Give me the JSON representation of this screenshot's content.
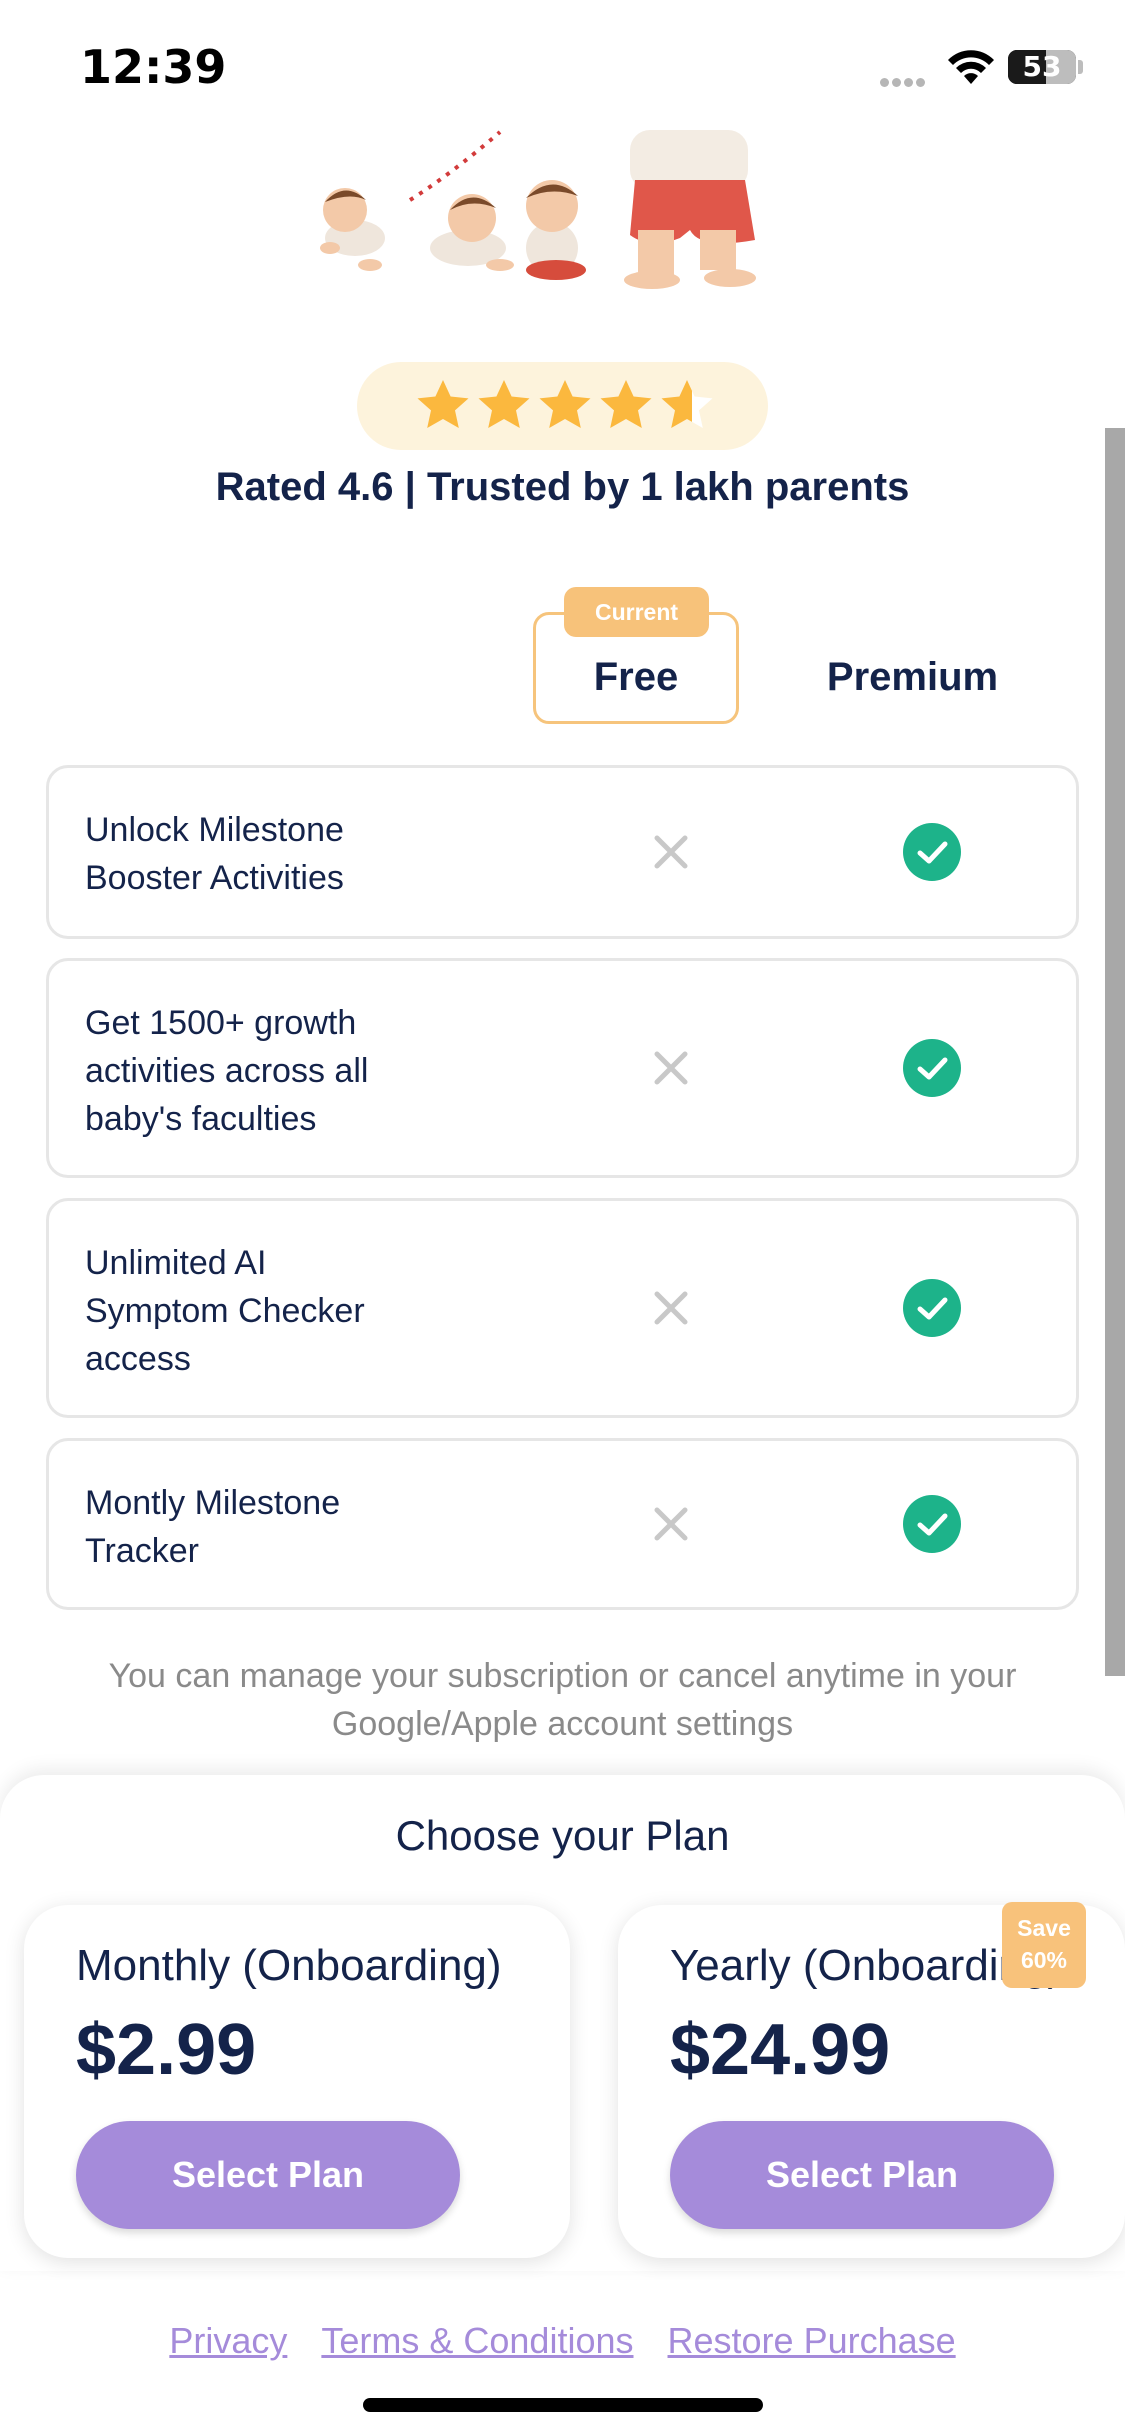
{
  "status_bar": {
    "time": "12:39",
    "battery_level": "53"
  },
  "rating": {
    "stars": 4.6,
    "text": "Rated 4.6 | Trusted by 1 lakh parents"
  },
  "comparison": {
    "current_badge": "Current",
    "free_label": "Free",
    "premium_label": "Premium",
    "features": [
      {
        "label": "Unlock Milestone\nBooster Activities",
        "free": false,
        "premium": true
      },
      {
        "label": "Get 1500+ growth\nactivities across all\nbaby's faculties",
        "free": false,
        "premium": true
      },
      {
        "label": "Unlimited AI\nSymptom Checker\naccess",
        "free": false,
        "premium": true
      },
      {
        "label": "Montly Milestone\nTracker",
        "free": false,
        "premium": true
      }
    ]
  },
  "note": "You can manage your subscription or cancel anytime in your Google/Apple account settings",
  "plans": {
    "title": "Choose your Plan",
    "monthly": {
      "name": "Monthly (Onboarding)",
      "price": "$2.99",
      "button": "Select Plan"
    },
    "yearly": {
      "name": "Yearly (Onboarding)",
      "price": "$24.99",
      "button": "Select Plan",
      "badge": "Save 60%"
    }
  },
  "footer": {
    "privacy": "Privacy",
    "terms": "Terms & Conditions",
    "restore": "Restore Purchase"
  },
  "colors": {
    "accent": "#a58bda",
    "check": "#1db38a",
    "badge": "#f7c27a",
    "text": "#14234a"
  }
}
